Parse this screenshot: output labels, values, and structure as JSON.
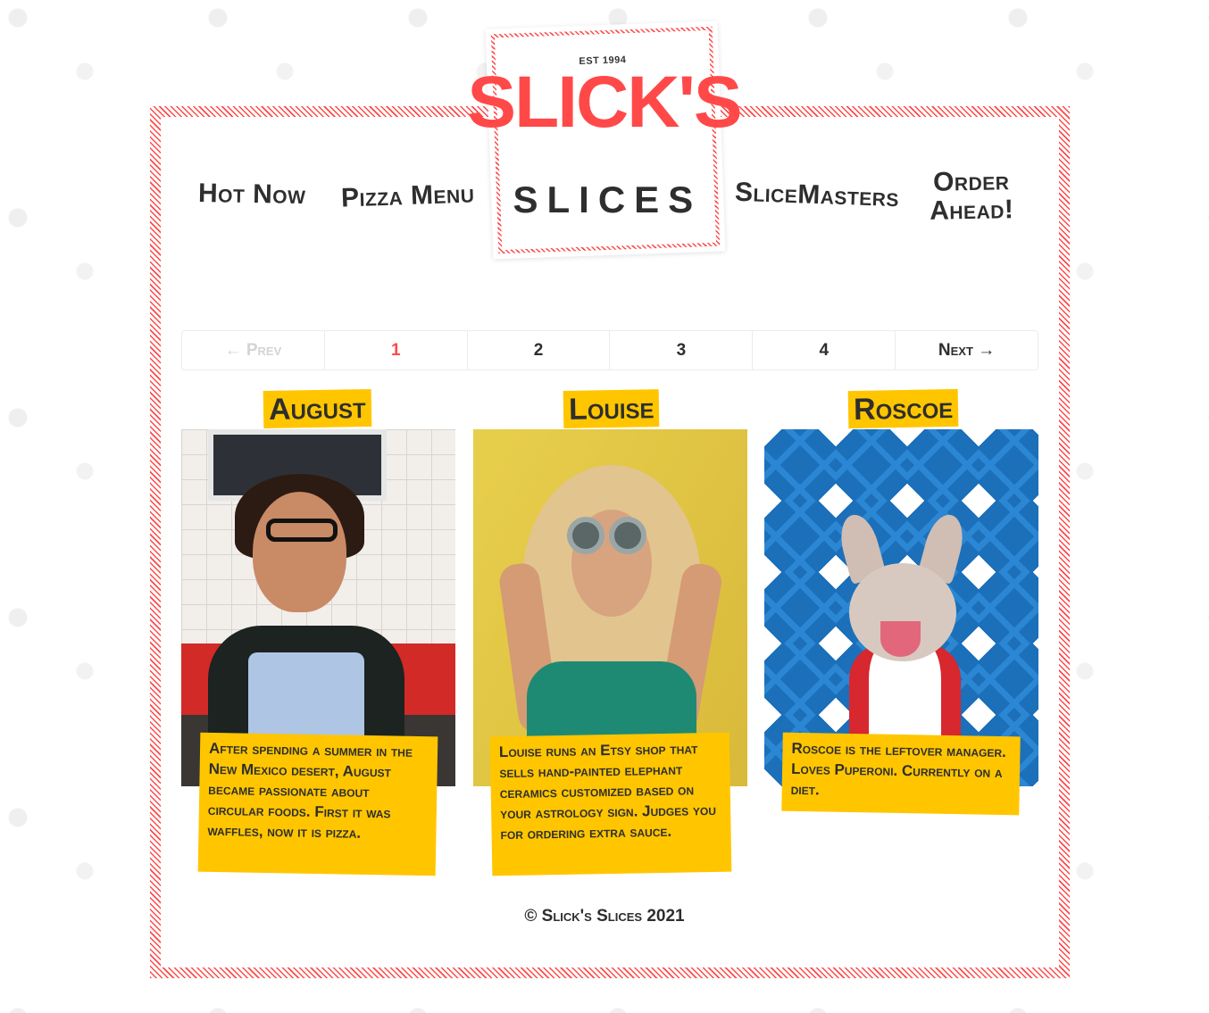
{
  "nav": {
    "hot_now": "Hot Now",
    "pizza_menu": "Pizza Menu",
    "slicemasters": "SliceMasters",
    "order_ahead": "Order Ahead!"
  },
  "logo": {
    "est": "EST 1994",
    "main": "SLICK'S",
    "sub": "SLICES"
  },
  "pagination": {
    "prev": "← Prev",
    "pages": [
      "1",
      "2",
      "3",
      "4"
    ],
    "current": "1",
    "next": "Next →"
  },
  "slicemasters": [
    {
      "name": "August",
      "description": "After spending a summer in the New Mexico desert, August became passionate about circular foods. First it was waffles, now it is pizza."
    },
    {
      "name": "Louise",
      "description": "Louise runs an Etsy shop that sells hand-painted elephant ceramics customized based on your astrology sign. Judges you for ordering extra sauce."
    },
    {
      "name": "Roscoe",
      "description": "Roscoe is the leftover manager. Loves Puperoni. Currently on a diet."
    }
  ],
  "footer": "© Slick's Slices 2021",
  "colors": {
    "accent_red": "#ff4949",
    "accent_yellow": "#ffc600",
    "text_dark": "#2e2e2e"
  }
}
